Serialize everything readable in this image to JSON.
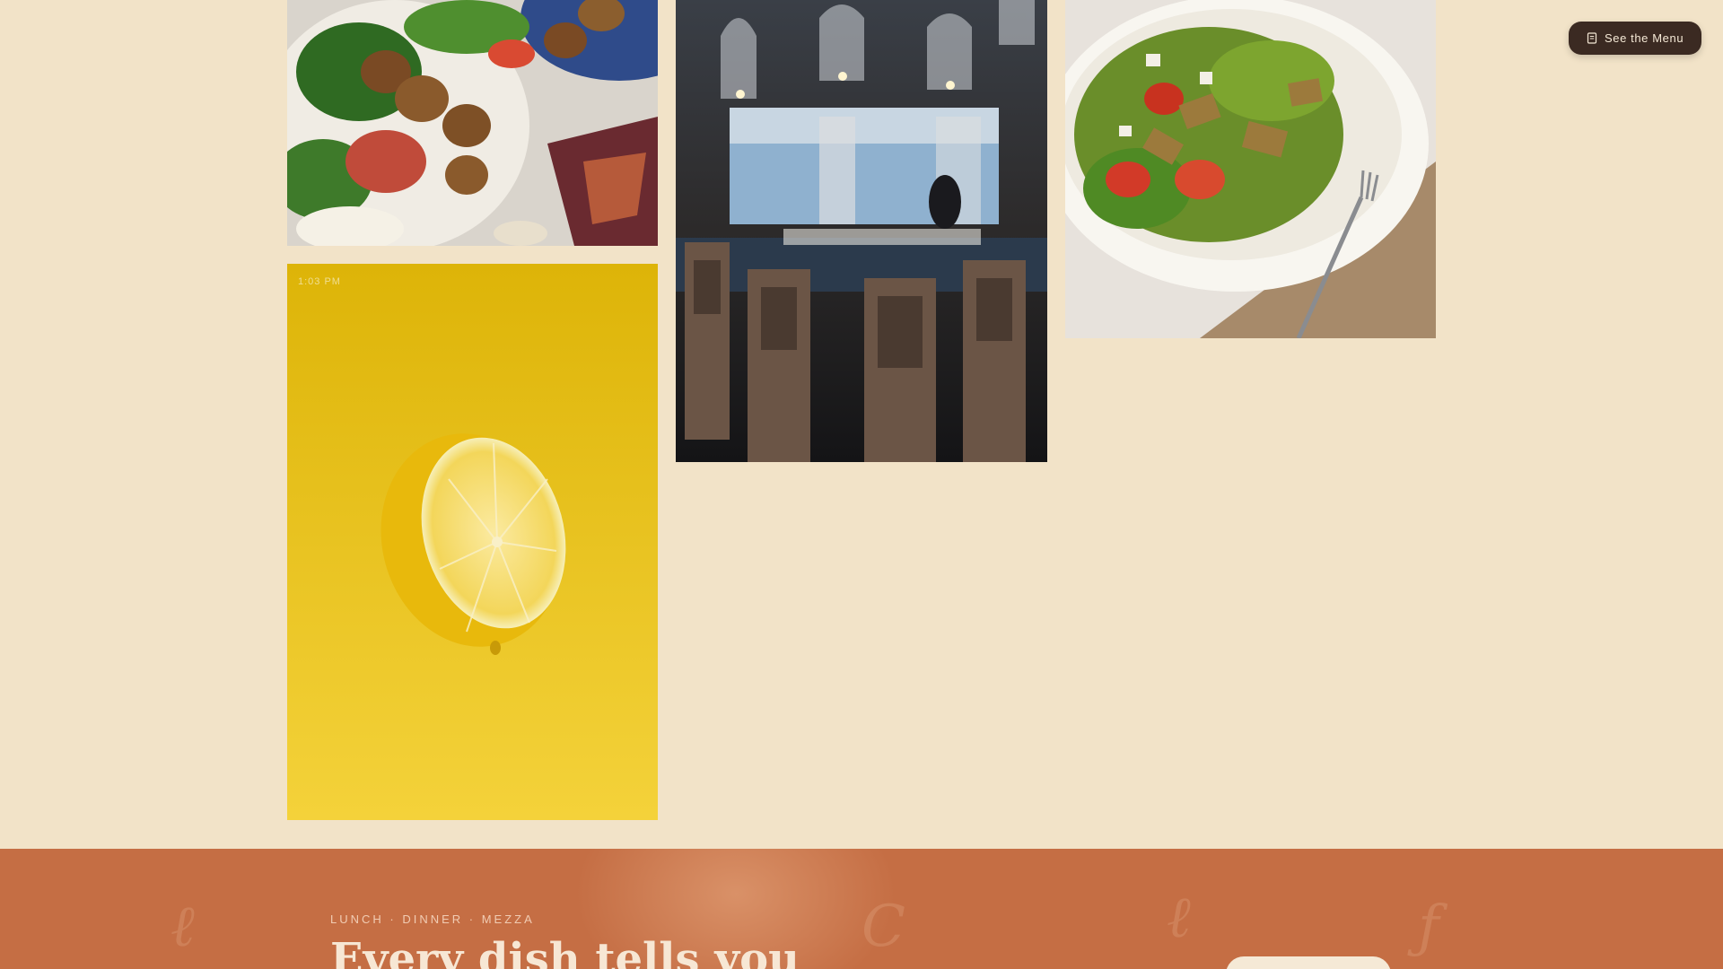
{
  "gallery": {
    "lemon_timestamp": "1:03 PM"
  },
  "header": {
    "menu_button_label": "See the Menu",
    "menu_button_icon": "menu-book-icon"
  },
  "promo": {
    "tagline": "LUNCH · DINNER · MEZZA",
    "headline": "Every dish tells you"
  },
  "colors": {
    "page_background": "#f2e3c8",
    "menu_button": "#3b2a22",
    "section_background": "#c56e44",
    "lemon_background": "#f2c521"
  }
}
